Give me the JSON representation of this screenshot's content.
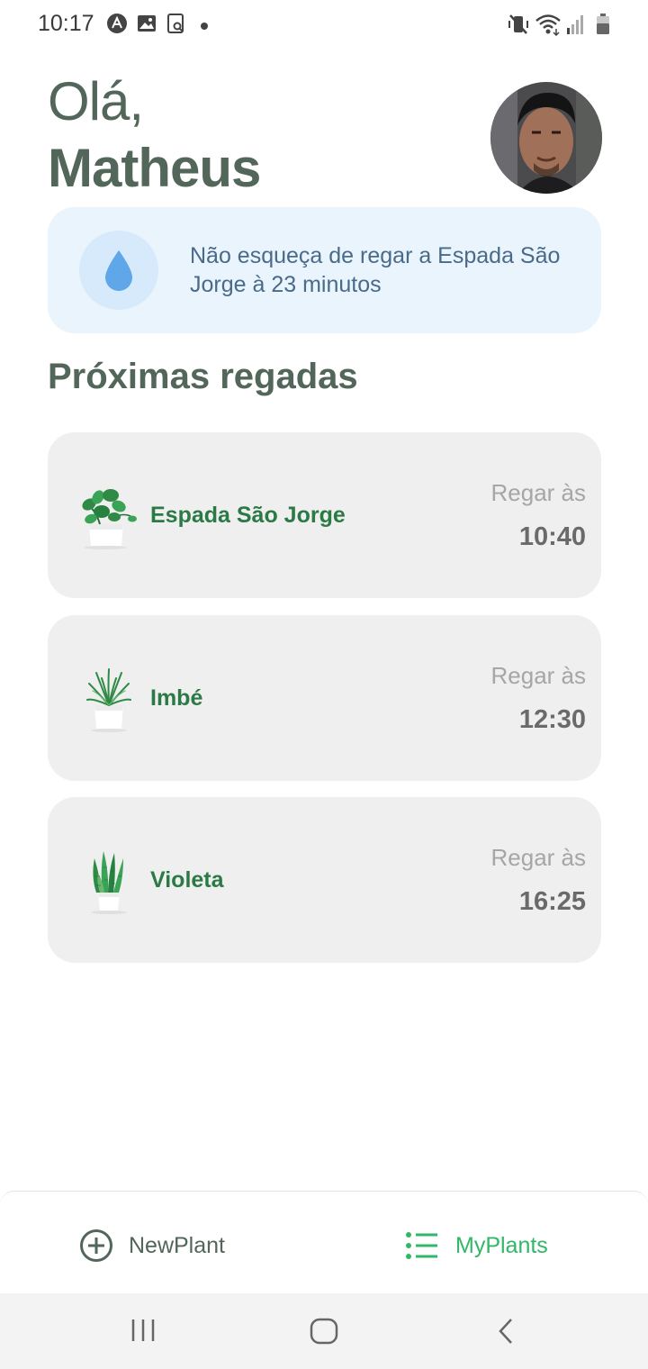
{
  "status_bar": {
    "time": "10:17",
    "left_icons": [
      "android-a-icon",
      "image-icon",
      "screen-search-icon",
      "dot-icon"
    ],
    "right_icons": [
      "mute-vibrate-icon",
      "wifi-icon",
      "signal-icon",
      "battery-icon"
    ]
  },
  "header": {
    "greeting": "Olá,",
    "name": "Matheus",
    "avatar": "avatar"
  },
  "alert": {
    "icon": "water-drop-icon",
    "text": "Não esqueça de regar a Espada São Jorge à 23 minutos"
  },
  "section": {
    "title": "Próximas regadas"
  },
  "plants": [
    {
      "name": "Espada São Jorge",
      "label": "Regar às",
      "time": "10:40",
      "icon": "pothos-plant-icon"
    },
    {
      "name": "Imbé",
      "label": "Regar às",
      "time": "12:30",
      "icon": "palm-plant-icon"
    },
    {
      "name": "Violeta",
      "label": "Regar às",
      "time": "16:25",
      "icon": "snake-plant-icon"
    }
  ],
  "tabs": [
    {
      "label": "NewPlant",
      "icon": "plus-circle-icon",
      "active": false
    },
    {
      "label": "MyPlants",
      "icon": "list-icon",
      "active": true
    }
  ],
  "colors": {
    "heading": "#52665a",
    "plant_name": "#2b7a46",
    "tab_active": "#32b768",
    "tab_inactive": "#52665a",
    "alert_bg": "#eaf4fd",
    "card_bg": "#efefef"
  },
  "system_nav": [
    "recents-icon",
    "home-icon",
    "back-icon"
  ]
}
